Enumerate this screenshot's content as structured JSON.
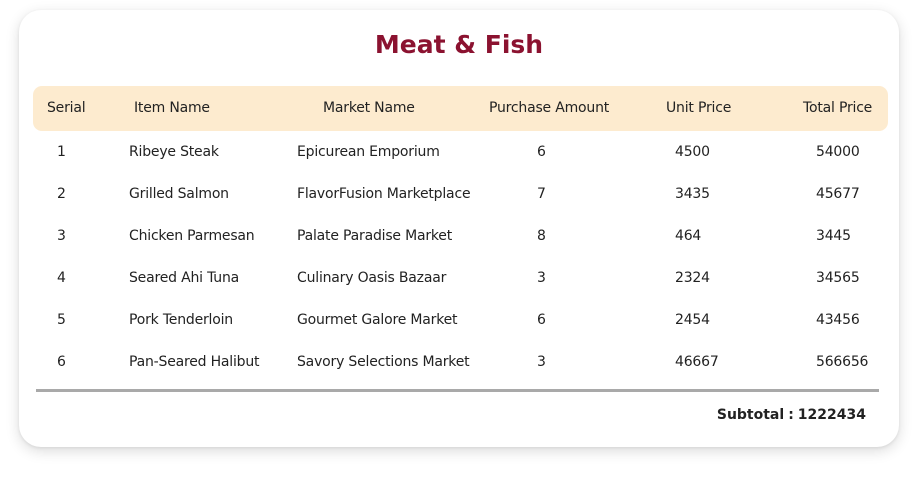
{
  "title": "Meat & Fish",
  "columns": {
    "serial": "Serial",
    "item_name": "Item Name",
    "market_name": "Market Name",
    "purchase_amount": "Purchase Amount",
    "unit_price": "Unit Price",
    "total_price": "Total Price"
  },
  "rows": [
    {
      "serial": "1",
      "item_name": "Ribeye Steak",
      "market_name": "Epicurean Emporium",
      "purchase_amount": "6",
      "unit_price": "4500",
      "total_price": "54000"
    },
    {
      "serial": "2",
      "item_name": "Grilled Salmon",
      "market_name": "FlavorFusion Marketplace",
      "purchase_amount": "7",
      "unit_price": "3435",
      "total_price": "45677"
    },
    {
      "serial": "3",
      "item_name": "Chicken Parmesan",
      "market_name": "Palate Paradise Market",
      "purchase_amount": "8",
      "unit_price": "464",
      "total_price": "3445"
    },
    {
      "serial": "4",
      "item_name": "Seared Ahi Tuna",
      "market_name": "Culinary Oasis Bazaar",
      "purchase_amount": "3",
      "unit_price": "2324",
      "total_price": "34565"
    },
    {
      "serial": "5",
      "item_name": "Pork Tenderloin",
      "market_name": "Gourmet Galore Market",
      "purchase_amount": "6",
      "unit_price": "2454",
      "total_price": "43456"
    },
    {
      "serial": "6",
      "item_name": "Pan-Seared Halibut",
      "market_name": "Savory Selections Market",
      "purchase_amount": "3",
      "unit_price": "46667",
      "total_price": "566656"
    }
  ],
  "subtotal": {
    "label": "Subtotal",
    "separator": ":",
    "value": "1222434"
  },
  "colors": {
    "title": "#8b1230",
    "header_bg": "#fdebcf",
    "divider": "#a9a9a9"
  }
}
